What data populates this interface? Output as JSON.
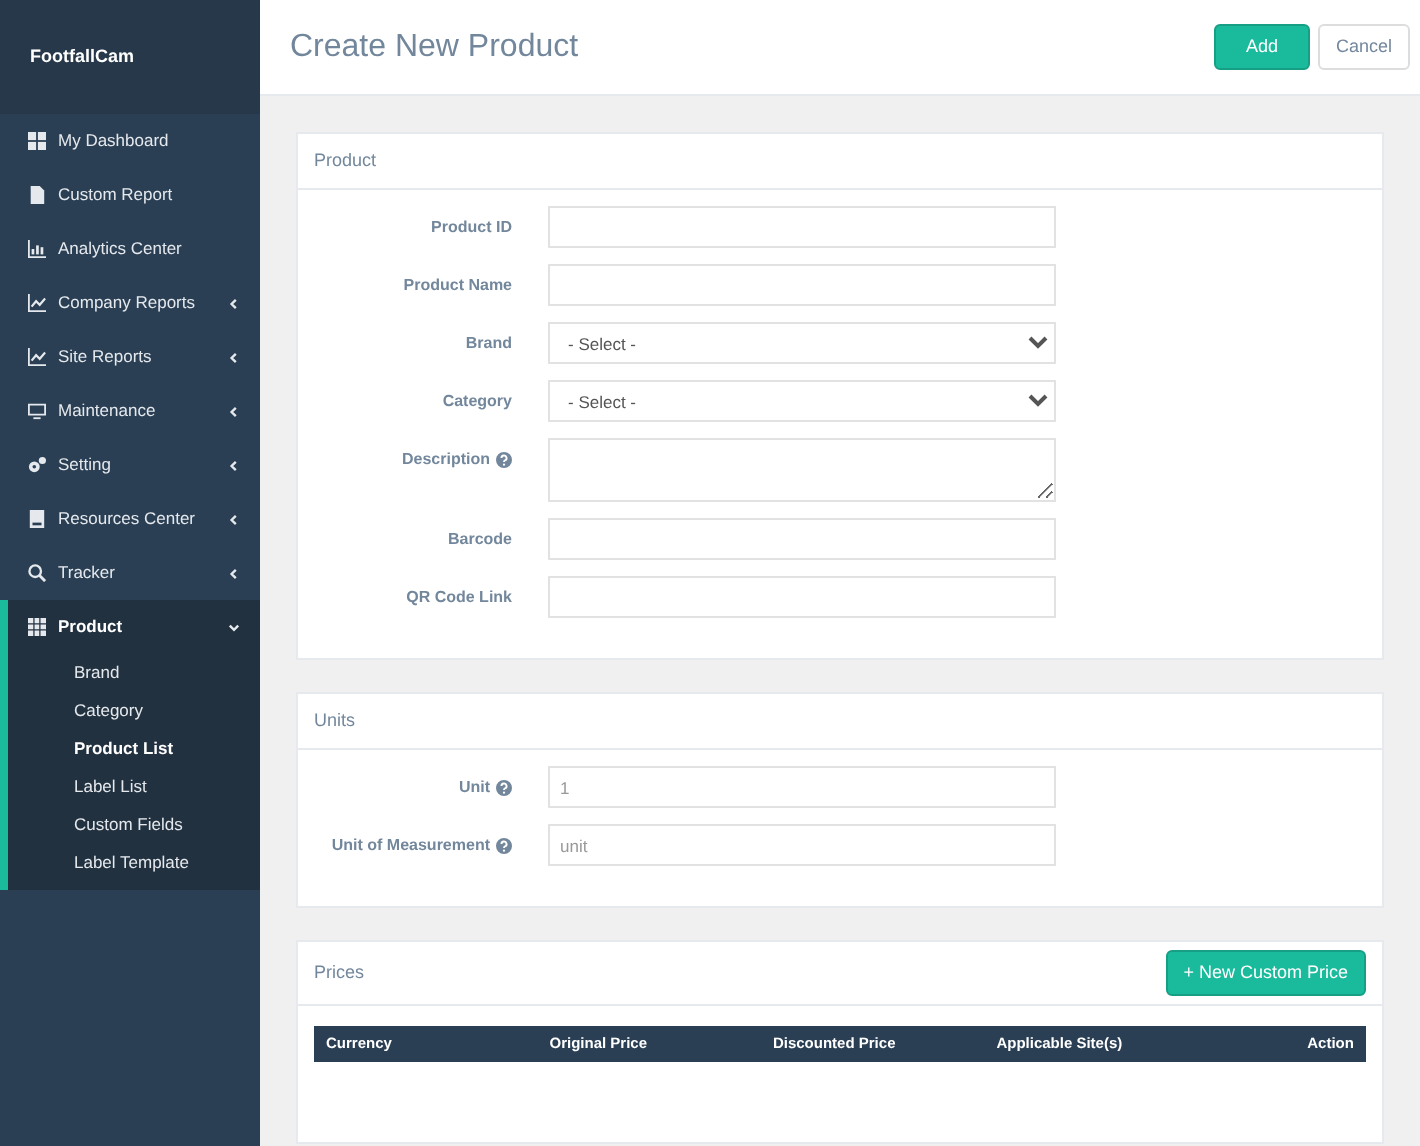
{
  "sidebar": {
    "brand": "FootfallCam",
    "items": [
      {
        "label": "My Dashboard",
        "expandable": false,
        "expanded": false
      },
      {
        "label": "Custom Report",
        "expandable": false,
        "expanded": false
      },
      {
        "label": "Analytics Center",
        "expandable": false,
        "expanded": false
      },
      {
        "label": "Company Reports",
        "expandable": true,
        "expanded": false
      },
      {
        "label": "Site Reports",
        "expandable": true,
        "expanded": false
      },
      {
        "label": "Maintenance",
        "expandable": true,
        "expanded": false
      },
      {
        "label": "Setting",
        "expandable": true,
        "expanded": false
      },
      {
        "label": "Resources Center",
        "expandable": true,
        "expanded": false
      },
      {
        "label": "Tracker",
        "expandable": true,
        "expanded": false
      },
      {
        "label": "Product",
        "expandable": true,
        "expanded": true,
        "children": [
          {
            "label": "Brand",
            "selected": false
          },
          {
            "label": "Category",
            "selected": false
          },
          {
            "label": "Product List",
            "selected": true
          },
          {
            "label": "Label List",
            "selected": false
          },
          {
            "label": "Custom Fields",
            "selected": false
          },
          {
            "label": "Label Template",
            "selected": false
          }
        ]
      }
    ]
  },
  "header": {
    "title": "Create New Product",
    "buttons": [
      {
        "label": "Add",
        "kind": "primary"
      },
      {
        "label": "Cancel",
        "kind": "default"
      }
    ]
  },
  "sections": [
    {
      "title": "Product",
      "fields": [
        {
          "label": "Product ID",
          "kind": "text",
          "help": false
        },
        {
          "label": "Product Name",
          "kind": "text",
          "help": false
        },
        {
          "label": "Brand",
          "kind": "select",
          "help": false,
          "value": "- Select -"
        },
        {
          "label": "Category",
          "kind": "select",
          "help": false,
          "value": "- Select -"
        },
        {
          "label": "Description",
          "kind": "textarea",
          "help": true
        },
        {
          "label": "Barcode",
          "kind": "text",
          "help": false
        },
        {
          "label": "QR Code Link",
          "kind": "text",
          "help": false
        }
      ]
    },
    {
      "title": "Units",
      "fields": [
        {
          "label": "Unit",
          "kind": "text",
          "help": true,
          "placeholder": "1"
        },
        {
          "label": "Unit of Measurement",
          "kind": "text",
          "help": true,
          "placeholder": "unit"
        }
      ]
    },
    {
      "title": "Prices",
      "button": "+ New Custom Price",
      "table": {
        "columns": [
          "Currency",
          "Original Price",
          "Discounted Price",
          "Applicable Site(s)",
          "Action"
        ]
      }
    }
  ]
}
